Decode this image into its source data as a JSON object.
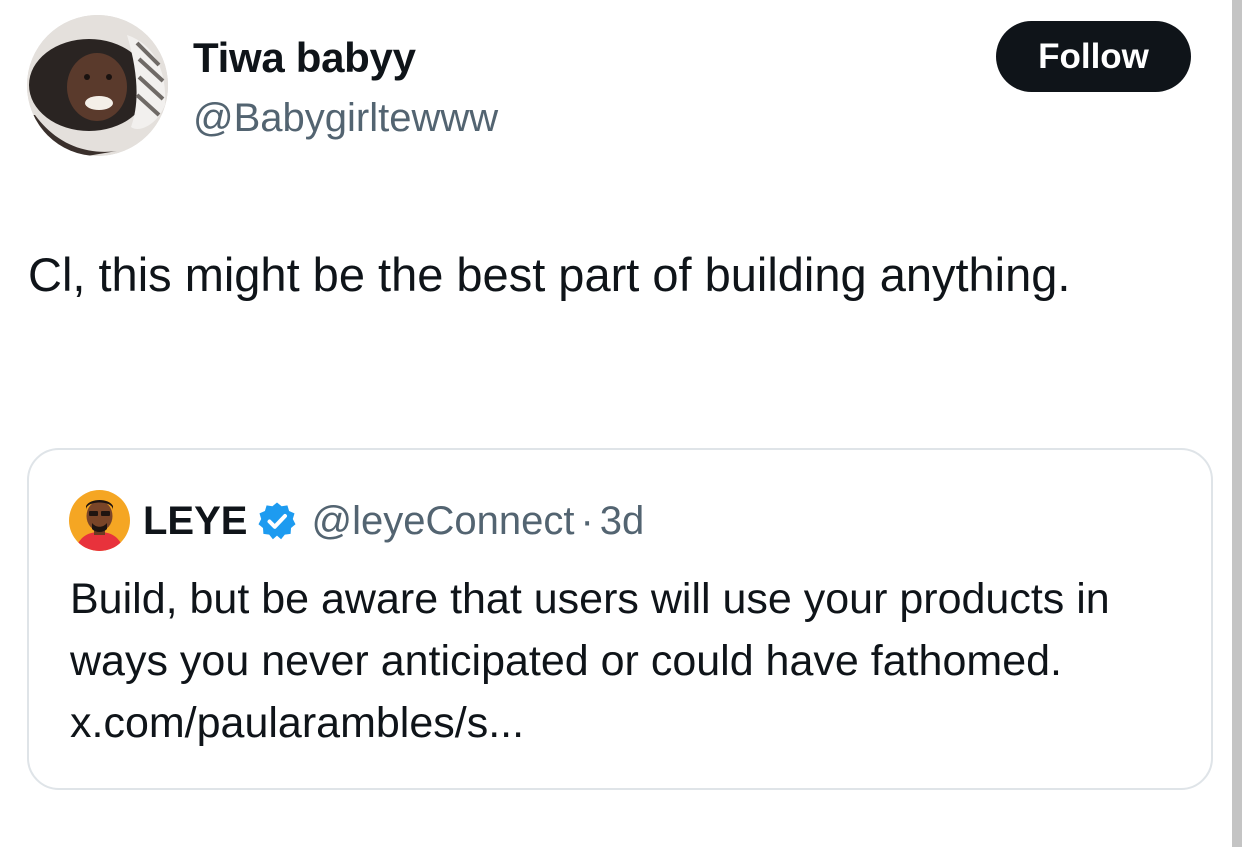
{
  "author": {
    "display_name": "Tiwa babyy",
    "handle": "@Babygirltewww"
  },
  "follow_button": {
    "label": "Follow"
  },
  "tweet": {
    "text": "Cl, this might be the best part of building anything."
  },
  "quoted_tweet": {
    "display_name": "LEYE",
    "verified": true,
    "handle": "@leyeConnect",
    "separator": "·",
    "age": "3d",
    "text": "Build, but be aware that users will use your products in ways you never anticipated or could have fathomed. x.com/paularambles/s..."
  },
  "colors": {
    "text_primary": "#0f1419",
    "text_secondary": "#536471",
    "follow_bg": "#0f1419",
    "verified_badge": "#1d9bf0",
    "card_border": "#dfe4e8"
  },
  "icons": {
    "author_avatar": "profile-photo",
    "quoted_avatar": "cartoon-avatar",
    "verified": "verified-badge-icon"
  }
}
